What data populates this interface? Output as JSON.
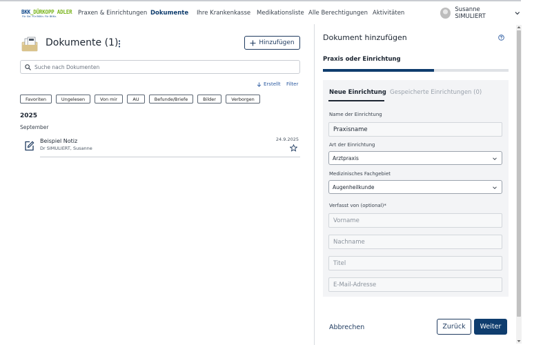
{
  "logo": {
    "brand": "BKK",
    "name": "DÜRKOPP ADLER",
    "tagline": "Für Sie. Für BKKn. Für BKKn."
  },
  "nav": {
    "items": [
      {
        "label": "Praxen & Einrichtungen",
        "active": false
      },
      {
        "label": "Dokumente",
        "active": true
      },
      {
        "label": "Ihre Krankenkasse",
        "active": false
      },
      {
        "label": "Medikationsliste",
        "active": false
      },
      {
        "label": "Alle Berechtigungen",
        "active": false
      },
      {
        "label": "Aktivitäten",
        "active": false
      }
    ],
    "user_name": "Susanne SIMULIERT"
  },
  "documents": {
    "title": "Dokumente (1)",
    "add_label": "Hinzufügen",
    "search_placeholder": "Suche nach Dokumenten",
    "sort_label": "Erstellt",
    "filter_label": "Filter",
    "chips": [
      "Favoriten",
      "Ungelesen",
      "Von mir",
      "AU",
      "Befunde/Briefe",
      "Bilder",
      "Verborgen"
    ],
    "year": "2025",
    "month": "September",
    "items": [
      {
        "title": "Beispiel Notiz",
        "author": "Dr SIMULIERT, Susanne",
        "date": "24.9.2025"
      }
    ]
  },
  "add_panel": {
    "title": "Dokument hinzufügen",
    "step_label": "Praxis oder Einrichtung",
    "progress_fraction": 0.6,
    "tabs": {
      "active": "Neue Einrichtung",
      "inactive": "Gespeicherte Einrichtungen (0)"
    },
    "fields": {
      "name_label": "Name der Einrichtung",
      "name_value": "Praxisname",
      "type_label": "Art der Einrichtung",
      "type_value": "Arztpraxis",
      "specialty_label": "Medizinisches Fachgebiet",
      "specialty_value": "Augenheilkunde",
      "author_label": "Verfasst von (optional)*",
      "firstname_placeholder": "Vorname",
      "lastname_placeholder": "Nachname",
      "title_placeholder": "Titel",
      "email_placeholder": "E-Mail-Adresse"
    },
    "cancel_label": "Abbrechen",
    "back_label": "Zurück",
    "next_label": "Weiter"
  },
  "colors": {
    "primary": "#0f3d6e",
    "link": "#2b5aa0",
    "brand_green": "#7ab51d"
  },
  "icons": [
    "documents-folder-icon",
    "kebab-menu-icon",
    "plus-icon",
    "search-icon",
    "sort-down-icon",
    "edit-note-icon",
    "star-icon",
    "help-icon",
    "chevron-down-icon"
  ]
}
